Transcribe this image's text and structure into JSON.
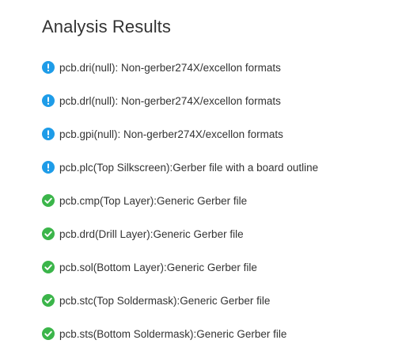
{
  "page": {
    "title": "Analysis Results"
  },
  "colors": {
    "info": "#1e9ce8",
    "success": "#3bb54a",
    "text": "#333333"
  },
  "results": [
    {
      "status": "info",
      "icon": "info-icon",
      "text": "pcb.dri(null): Non-gerber274X/excellon formats"
    },
    {
      "status": "info",
      "icon": "info-icon",
      "text": "pcb.drl(null): Non-gerber274X/excellon formats"
    },
    {
      "status": "info",
      "icon": "info-icon",
      "text": "pcb.gpi(null): Non-gerber274X/excellon formats"
    },
    {
      "status": "info",
      "icon": "info-icon",
      "text": "pcb.plc(Top Silkscreen):Gerber file with a board outline"
    },
    {
      "status": "success",
      "icon": "check-circle-icon",
      "text": "pcb.cmp(Top Layer):Generic Gerber file"
    },
    {
      "status": "success",
      "icon": "check-circle-icon",
      "text": "pcb.drd(Drill Layer):Generic Gerber file"
    },
    {
      "status": "success",
      "icon": "check-circle-icon",
      "text": "pcb.sol(Bottom Layer):Generic Gerber file"
    },
    {
      "status": "success",
      "icon": "check-circle-icon",
      "text": "pcb.stc(Top Soldermask):Generic Gerber file"
    },
    {
      "status": "success",
      "icon": "check-circle-icon",
      "text": "pcb.sts(Bottom Soldermask):Generic Gerber file"
    }
  ]
}
